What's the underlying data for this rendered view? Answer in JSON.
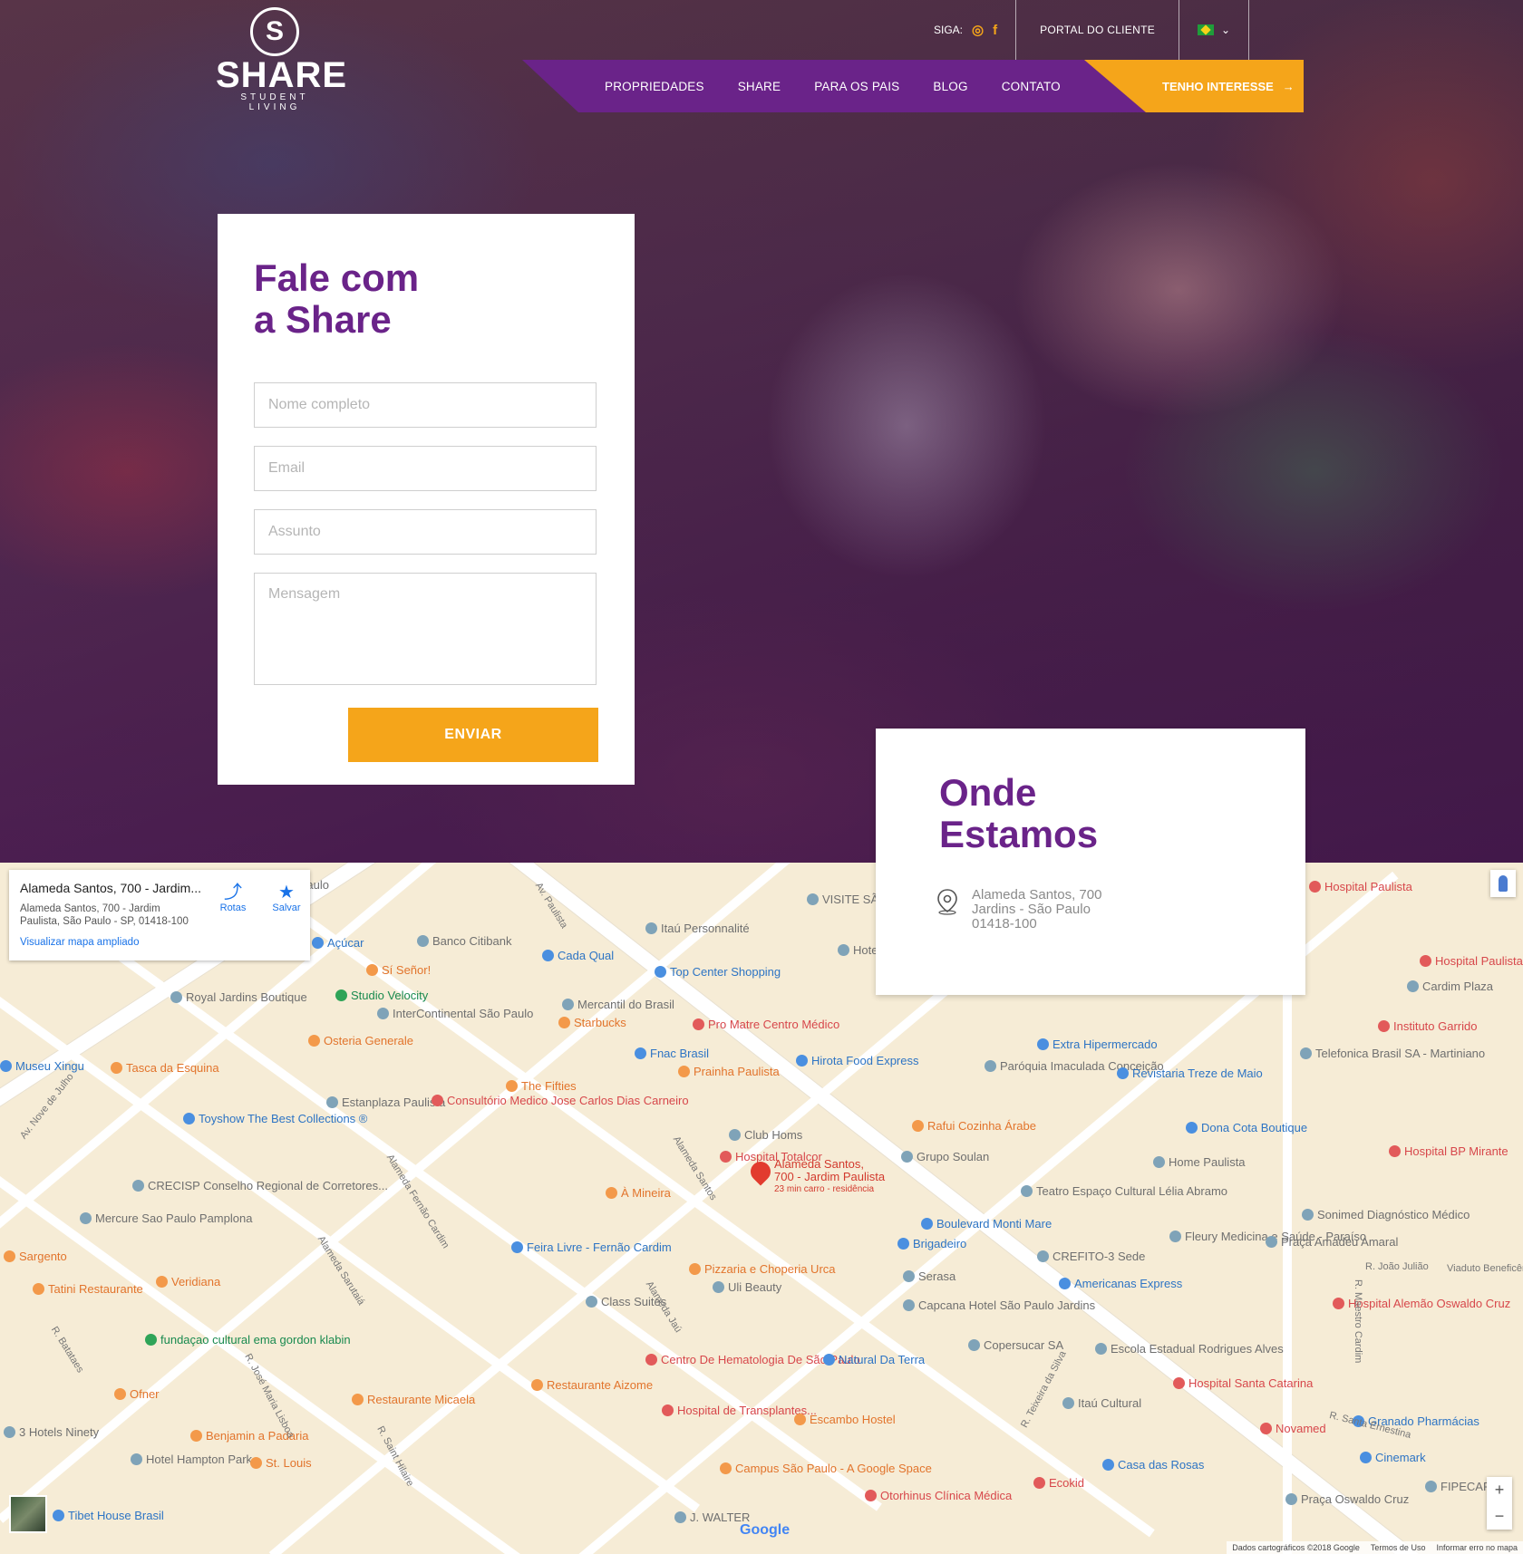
{
  "brand": {
    "logo_word": "SHARE",
    "logo_sub": "STUDENT LIVING"
  },
  "topbar": {
    "follow_label": "SIGA:",
    "social": [
      "instagram-icon",
      "facebook-icon"
    ],
    "portal_label": "PORTAL DO CLIENTE",
    "language": "pt-BR"
  },
  "nav": {
    "items": [
      "PROPRIEDADES",
      "SHARE",
      "PARA OS PAIS",
      "BLOG",
      "CONTATO"
    ],
    "cta_label": "TENHO INTERESSE"
  },
  "contact_form": {
    "title": "Fale com\na Share",
    "name_placeholder": "Nome completo",
    "email_placeholder": "Email",
    "subject_placeholder": "Assunto",
    "message_placeholder": "Mensagem",
    "submit_label": "ENVIAR"
  },
  "location": {
    "title": "Onde\nEstamos",
    "address_line1": "Alameda Santos, 700",
    "address_line2": "Jardins - São Paulo",
    "address_line3": "01418-100"
  },
  "map": {
    "info_title": "Alameda Santos, 700 - Jardim...",
    "info_address": "Alameda Santos, 700 - Jardim Paulista, São Paulo - SP, 01418-100",
    "info_link": "Visualizar mapa ampliado",
    "routes_label": "Rotas",
    "save_label": "Salvar",
    "marker_label_1": "Alameda Santos,",
    "marker_label_2": "700 - Jardim Paulista",
    "marker_sub": "23 min carro - residência",
    "google_label": "Google",
    "attribution": [
      "Dados cartográficos ©2018 Google",
      "Termos de Uso",
      "Informar erro no mapa"
    ],
    "pois": [
      {
        "text": "São Paulo",
        "color": "grey"
      },
      {
        "text": "Banco Citibank",
        "color": "grey"
      },
      {
        "text": "Açúcar",
        "color": "blue"
      },
      {
        "text": "Sí Señor!",
        "color": "orange"
      },
      {
        "text": "Studio Velocity",
        "color": "green"
      },
      {
        "text": "Royal Jardins Boutique",
        "color": "grey"
      },
      {
        "text": "InterContinental São Paulo",
        "color": "grey"
      },
      {
        "text": "Osteria Generale",
        "color": "orange"
      },
      {
        "text": "Museu Xingu",
        "color": "blue"
      },
      {
        "text": "Tasca da Esquina",
        "color": "orange"
      },
      {
        "text": "Estanplaza Paulista",
        "color": "grey"
      },
      {
        "text": "Toyshow The Best Collections ®",
        "color": "blue"
      },
      {
        "text": "CRECISP Conselho Regional de Corretores...",
        "color": "grey"
      },
      {
        "text": "Mercure Sao Paulo Pamplona",
        "color": "grey"
      },
      {
        "text": "Sargento",
        "color": "orange"
      },
      {
        "text": "Tatini Restaurante",
        "color": "orange"
      },
      {
        "text": "Veridiana",
        "color": "orange"
      },
      {
        "text": "fundaçao cultural ema gordon klabin",
        "color": "green"
      },
      {
        "text": "Ofner",
        "color": "orange"
      },
      {
        "text": "3 Hotels Ninety",
        "color": "grey"
      },
      {
        "text": "Benjamin a Padaria",
        "color": "orange"
      },
      {
        "text": "Hotel Hampton Park",
        "color": "grey"
      },
      {
        "text": "St. Louis",
        "color": "orange"
      },
      {
        "text": "Tibet House Brasil",
        "color": "blue"
      },
      {
        "text": "Itaú Personnalité",
        "color": "grey"
      },
      {
        "text": "Cada Qual",
        "color": "blue"
      },
      {
        "text": "Top Center Shopping",
        "color": "blue"
      },
      {
        "text": "Mercantil do Brasil",
        "color": "grey"
      },
      {
        "text": "Starbucks",
        "color": "orange"
      },
      {
        "text": "Pro Matre Centro Médico",
        "color": "red"
      },
      {
        "text": "Fnac Brasil",
        "color": "blue"
      },
      {
        "text": "Prainha Paulista",
        "color": "orange"
      },
      {
        "text": "Hirota Food Express",
        "color": "blue"
      },
      {
        "text": "The Fifties",
        "color": "orange"
      },
      {
        "text": "Consultório Medico Jose Carlos Dias Carneiro",
        "color": "red"
      },
      {
        "text": "Club Homs",
        "color": "grey"
      },
      {
        "text": "Hospital Totalcor",
        "color": "red"
      },
      {
        "text": "À Mineira",
        "color": "orange"
      },
      {
        "text": "Feira Livre - Fernão Cardim",
        "color": "blue"
      },
      {
        "text": "Pizzaria e Choperia Urca",
        "color": "orange"
      },
      {
        "text": "Uli Beauty",
        "color": "grey"
      },
      {
        "text": "Class Suites",
        "color": "grey"
      },
      {
        "text": "Centro De Hematologia De São Paulo",
        "color": "red"
      },
      {
        "text": "Natural Da Terra",
        "color": "blue"
      },
      {
        "text": "Restaurante Aizome",
        "color": "orange"
      },
      {
        "text": "Restaurante Micaela",
        "color": "orange"
      },
      {
        "text": "Hospital de Transplantes...",
        "color": "red"
      },
      {
        "text": "Escambo Hostel",
        "color": "orange"
      },
      {
        "text": "Campus São Paulo - A Google Space",
        "color": "orange"
      },
      {
        "text": "Otorhinus Clínica Médica",
        "color": "red"
      },
      {
        "text": "J. WALTER",
        "color": "grey"
      },
      {
        "text": "Extra Hipermercado",
        "color": "blue"
      },
      {
        "text": "Paróquia Imaculada Conceição",
        "color": "grey"
      },
      {
        "text": "Revistaria Treze de Maio",
        "color": "blue"
      },
      {
        "text": "Rafui Cozinha Árabe",
        "color": "orange"
      },
      {
        "text": "Grupo Soulan",
        "color": "grey"
      },
      {
        "text": "Dona Cota Boutique",
        "color": "blue"
      },
      {
        "text": "Home Paulista",
        "color": "grey"
      },
      {
        "text": "Teatro Espaço Cultural Lélia Abramo",
        "color": "grey"
      },
      {
        "text": "Boulevard Monti Mare",
        "color": "blue"
      },
      {
        "text": "Brigadeiro",
        "color": "blue"
      },
      {
        "text": "CREFITO-3 Sede",
        "color": "grey"
      },
      {
        "text": "Fleury Medicina e Saúde - Paraíso",
        "color": "grey"
      },
      {
        "text": "Serasa",
        "color": "grey"
      },
      {
        "text": "Americanas Express",
        "color": "blue"
      },
      {
        "text": "Capcana Hotel São Paulo Jardins",
        "color": "grey"
      },
      {
        "text": "Copersucar SA",
        "color": "grey"
      },
      {
        "text": "Escola Estadual Rodrigues Alves",
        "color": "grey"
      },
      {
        "text": "Itaú Cultural",
        "color": "grey"
      },
      {
        "text": "Hospital Santa Catarina",
        "color": "red"
      },
      {
        "text": "Novamed",
        "color": "red"
      },
      {
        "text": "Casa das Rosas",
        "color": "blue"
      },
      {
        "text": "Ecokid",
        "color": "red"
      },
      {
        "text": "Hospital Paulistano",
        "color": "red"
      },
      {
        "text": "Cardim Plaza",
        "color": "grey"
      },
      {
        "text": "Instituto Garrido",
        "color": "red"
      },
      {
        "text": "Telefonica Brasil SA - Martiniano",
        "color": "grey"
      },
      {
        "text": "Hospital BP Mirante",
        "color": "red"
      },
      {
        "text": "Sonimed Diagnóstico Médico",
        "color": "grey"
      },
      {
        "text": "Praça Amadeu Amaral",
        "color": "grey"
      },
      {
        "text": "Hospital Alemão Oswaldo Cruz",
        "color": "red"
      },
      {
        "text": "Granado Pharmácias",
        "color": "blue"
      },
      {
        "text": "Cinemark",
        "color": "blue"
      },
      {
        "text": "FIPECAFI",
        "color": "grey"
      },
      {
        "text": "Praça Oswaldo Cruz",
        "color": "grey"
      },
      {
        "text": "Hospital Paulista",
        "color": "red"
      },
      {
        "text": "VISITE SÃO PAULO",
        "color": "grey"
      },
      {
        "text": "Hotel Avenida",
        "color": "grey"
      }
    ],
    "streets": [
      "Av. Paulista",
      "Av. Nove de Julho",
      "Alameda Santos",
      "Alameda Fernão Cardim",
      "Alameda Jaú",
      "Alameda Sarutaiá",
      "R. Batataes",
      "R. José Maria Lisboa",
      "R. Saint Hilaire",
      "R. Teixeira da Silva",
      "R. Santa Ernestina",
      "R. João Julião",
      "R. Maestro Cardim",
      "Viaduto Beneficência"
    ]
  }
}
